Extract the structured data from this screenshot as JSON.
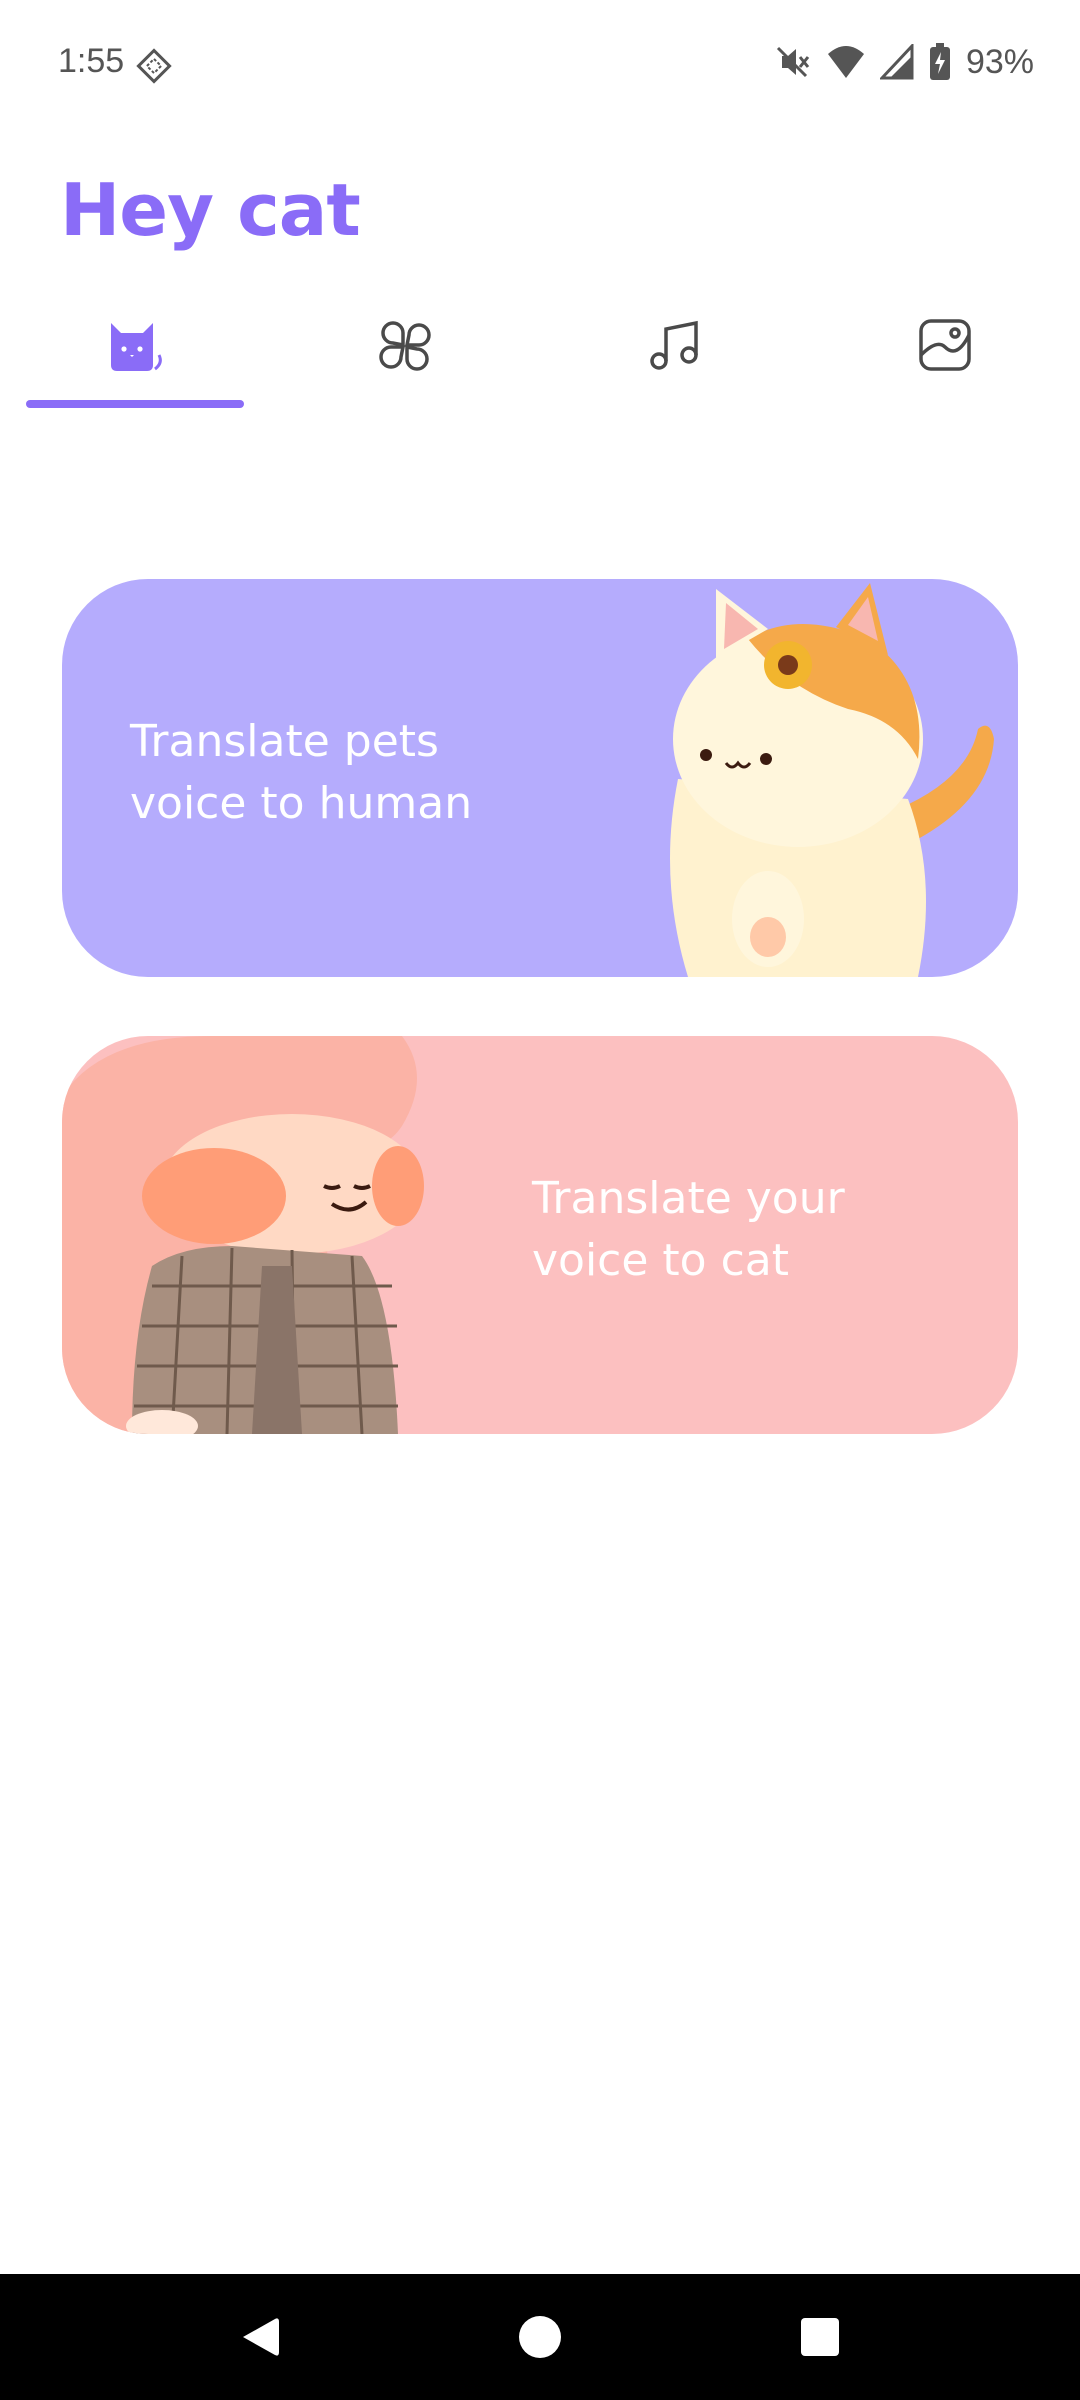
{
  "status_bar": {
    "time": "1:55",
    "battery_percent": "93%",
    "icons": [
      "diamond-notification-icon",
      "mute-icon",
      "wifi-icon",
      "signal-icon",
      "battery-charging-icon"
    ]
  },
  "app": {
    "title": "Hey cat",
    "accent_color": "#8a6cf7"
  },
  "tabs": [
    {
      "icon": "cat-icon",
      "selected": true
    },
    {
      "icon": "clover-grid-icon",
      "selected": false
    },
    {
      "icon": "music-note-icon",
      "selected": false
    },
    {
      "icon": "sticker-icon",
      "selected": false
    }
  ],
  "cards": [
    {
      "text": "Translate pets voice to human",
      "color": "#b5acfd",
      "image": "cat-illustration"
    },
    {
      "text": "Translate your voice to cat",
      "color": "#fcc0c0",
      "image": "girl-illustration"
    }
  ],
  "nav_bar": {
    "buttons": [
      "back-icon",
      "home-icon",
      "recents-icon"
    ]
  }
}
